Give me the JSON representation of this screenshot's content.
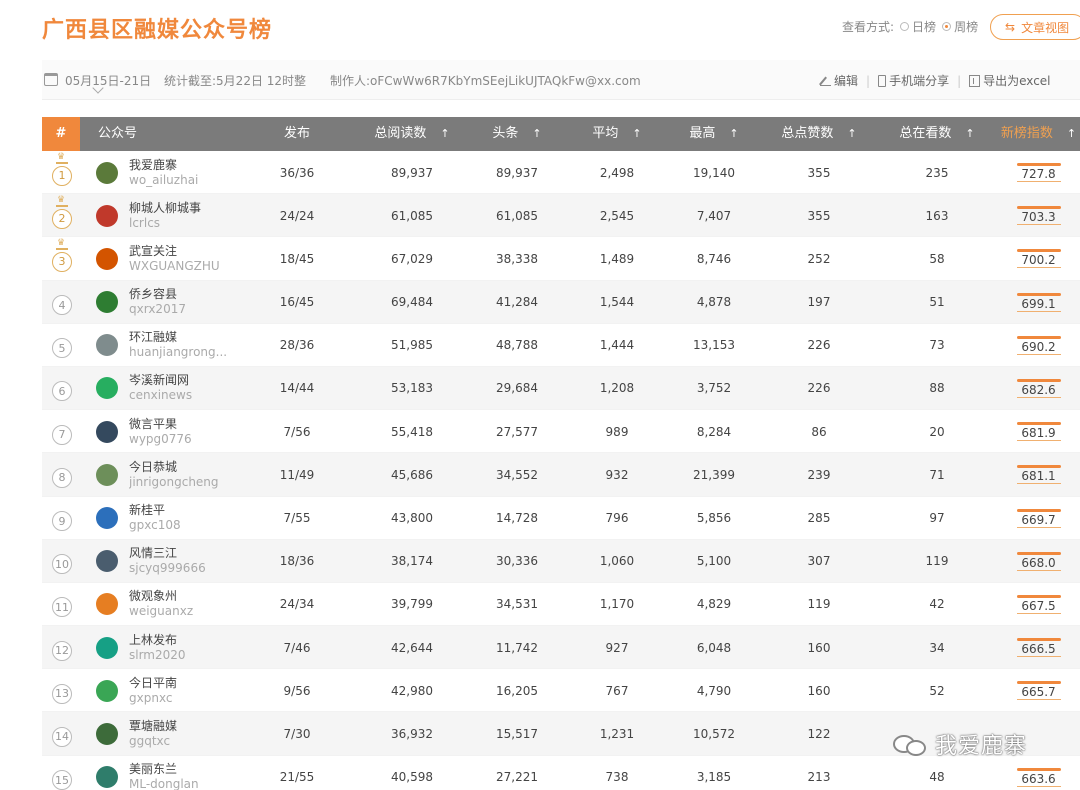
{
  "header": {
    "title": "广西县区融媒公众号榜",
    "view_label": "查看方式:",
    "daily_label": "日榜",
    "weekly_label": "周榜",
    "article_view_label": "文章视图"
  },
  "info": {
    "date_range": "05月15日-21日",
    "stat_date": "统计截至:5月22日 12时整",
    "author": "制作人:oFCwWw6R7KbYmSEejLikUJTAQkFw@xx.com",
    "edit_label": "编辑",
    "mobile_share_label": "手机端分享",
    "export_label": "导出为excel"
  },
  "table": {
    "headers": {
      "rank": "#",
      "account": "公众号",
      "published": "发布",
      "total_reads": "总阅读数",
      "headline": "头条",
      "average": "平均",
      "max": "最高",
      "total_likes": "总点赞数",
      "total_watching": "总在看数",
      "score": "新榜指数"
    },
    "rows": [
      {
        "rank": "1",
        "name": "我爱鹿寨",
        "id": "wo_ailuzhai",
        "published": "36/36",
        "reads": "89,937",
        "headline": "89,937",
        "avg": "2,498",
        "max": "19,140",
        "likes": "355",
        "watching": "235",
        "score": "727.8",
        "avatar_color": "#5b7a3a"
      },
      {
        "rank": "2",
        "name": "柳城人柳城事",
        "id": "lcrlcs",
        "published": "24/24",
        "reads": "61,085",
        "headline": "61,085",
        "avg": "2,545",
        "max": "7,407",
        "likes": "355",
        "watching": "163",
        "score": "703.3",
        "avatar_color": "#c0392b"
      },
      {
        "rank": "3",
        "name": "武宣关注",
        "id": "WXGUANGZHU",
        "published": "18/45",
        "reads": "67,029",
        "headline": "38,338",
        "avg": "1,489",
        "max": "8,746",
        "likes": "252",
        "watching": "58",
        "score": "700.2",
        "avatar_color": "#d35400"
      },
      {
        "rank": "4",
        "name": "侨乡容县",
        "id": "qxrx2017",
        "published": "16/45",
        "reads": "69,484",
        "headline": "41,284",
        "avg": "1,544",
        "max": "4,878",
        "likes": "197",
        "watching": "51",
        "score": "699.1",
        "avatar_color": "#2e7d32"
      },
      {
        "rank": "5",
        "name": "环江融媒",
        "id": "huanjiangrong...",
        "published": "28/36",
        "reads": "51,985",
        "headline": "48,788",
        "avg": "1,444",
        "max": "13,153",
        "likes": "226",
        "watching": "73",
        "score": "690.2",
        "avatar_color": "#7f8c8d"
      },
      {
        "rank": "6",
        "name": "岑溪新闻网",
        "id": "cenxinews",
        "published": "14/44",
        "reads": "53,183",
        "headline": "29,684",
        "avg": "1,208",
        "max": "3,752",
        "likes": "226",
        "watching": "88",
        "score": "682.6",
        "avatar_color": "#27ae60"
      },
      {
        "rank": "7",
        "name": "微言平果",
        "id": "wypg0776",
        "published": "7/56",
        "reads": "55,418",
        "headline": "27,577",
        "avg": "989",
        "max": "8,284",
        "likes": "86",
        "watching": "20",
        "score": "681.9",
        "avatar_color": "#34495e"
      },
      {
        "rank": "8",
        "name": "今日恭城",
        "id": "jinrigongcheng",
        "published": "11/49",
        "reads": "45,686",
        "headline": "34,552",
        "avg": "932",
        "max": "21,399",
        "likes": "239",
        "watching": "71",
        "score": "681.1",
        "avatar_color": "#6d8f5a"
      },
      {
        "rank": "9",
        "name": "新桂平",
        "id": "gpxc108",
        "published": "7/55",
        "reads": "43,800",
        "headline": "14,728",
        "avg": "796",
        "max": "5,856",
        "likes": "285",
        "watching": "97",
        "score": "669.7",
        "avatar_color": "#2c6fbb"
      },
      {
        "rank": "10",
        "name": "风情三江",
        "id": "sjcyq999666",
        "published": "18/36",
        "reads": "38,174",
        "headline": "30,336",
        "avg": "1,060",
        "max": "5,100",
        "likes": "307",
        "watching": "119",
        "score": "668.0",
        "avatar_color": "#4a5d6e"
      },
      {
        "rank": "11",
        "name": "微观象州",
        "id": "weiguanxz",
        "published": "24/34",
        "reads": "39,799",
        "headline": "34,531",
        "avg": "1,170",
        "max": "4,829",
        "likes": "119",
        "watching": "42",
        "score": "667.5",
        "avatar_color": "#e67e22"
      },
      {
        "rank": "12",
        "name": "上林发布",
        "id": "slrm2020",
        "published": "7/46",
        "reads": "42,644",
        "headline": "11,742",
        "avg": "927",
        "max": "6,048",
        "likes": "160",
        "watching": "34",
        "score": "666.5",
        "avatar_color": "#16a085"
      },
      {
        "rank": "13",
        "name": "今日平南",
        "id": "gxpnxc",
        "published": "9/56",
        "reads": "42,980",
        "headline": "16,205",
        "avg": "767",
        "max": "4,790",
        "likes": "160",
        "watching": "52",
        "score": "665.7",
        "avatar_color": "#3aa655"
      },
      {
        "rank": "14",
        "name": "覃塘融媒",
        "id": "ggqtxc",
        "published": "7/30",
        "reads": "36,932",
        "headline": "15,517",
        "avg": "1,231",
        "max": "10,572",
        "likes": "122",
        "watching": "",
        "score": "",
        "avatar_color": "#3d6b3a"
      },
      {
        "rank": "15",
        "name": "美丽东兰",
        "id": "ML-donglan",
        "published": "21/55",
        "reads": "40,598",
        "headline": "27,221",
        "avg": "738",
        "max": "3,185",
        "likes": "213",
        "watching": "48",
        "score": "663.6",
        "avatar_color": "#2f7d6b"
      }
    ]
  },
  "watermark": {
    "text": "我爱鹿寨"
  },
  "colors": {
    "accent": "#f0883c",
    "header_bg": "#7b7b7b",
    "gold": "#e0b060"
  }
}
